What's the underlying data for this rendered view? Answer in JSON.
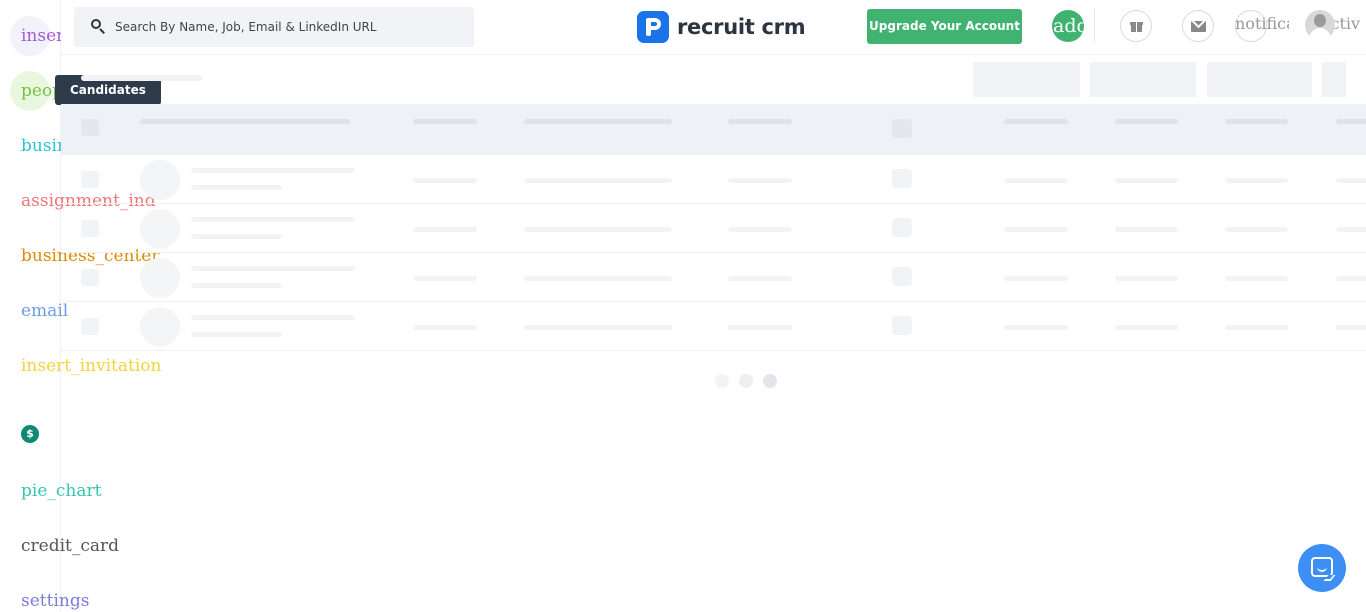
{
  "sidebar": {
    "items": [
      {
        "label": "inser",
        "color": "#a35cd6"
      },
      {
        "label": "people",
        "color": "#76c043"
      },
      {
        "label": "business",
        "color": "#28c3d4"
      },
      {
        "label": "assignment_ind",
        "color": "#f07575"
      },
      {
        "label": "business_center",
        "color": "#e08a00"
      },
      {
        "label": "email",
        "color": "#6f9be8"
      },
      {
        "label": "insert_invitation",
        "color": "#f5d33b"
      },
      {
        "label": "$",
        "icon": "dollar-icon",
        "color": "#0e8a73"
      },
      {
        "label": "pie_chart",
        "color": "#37c6b0"
      },
      {
        "label": "credit_card",
        "color": "#555555"
      },
      {
        "label": "settings",
        "color": "#7b7bdc"
      }
    ],
    "tooltip": "Candidates"
  },
  "header": {
    "search_placeholder": "Search By Name, Job, Email & LinkedIn URL",
    "logo_text": "recruit crm",
    "upgrade_label": "Upgrade Your Account",
    "add_label": "add",
    "notifications_label": "notifications",
    "activity_label": "activ",
    "icons": [
      "search-icon",
      "gift-icon",
      "mail-icon",
      "notifications-icon",
      "avatar"
    ],
    "brand_color": "#1a73e8",
    "accent_color": "#3fb36f"
  },
  "content": {
    "state": "loading",
    "skeleton_rows": 4
  },
  "chat": {
    "icon": "chat-icon",
    "color": "#3d8ef5"
  }
}
